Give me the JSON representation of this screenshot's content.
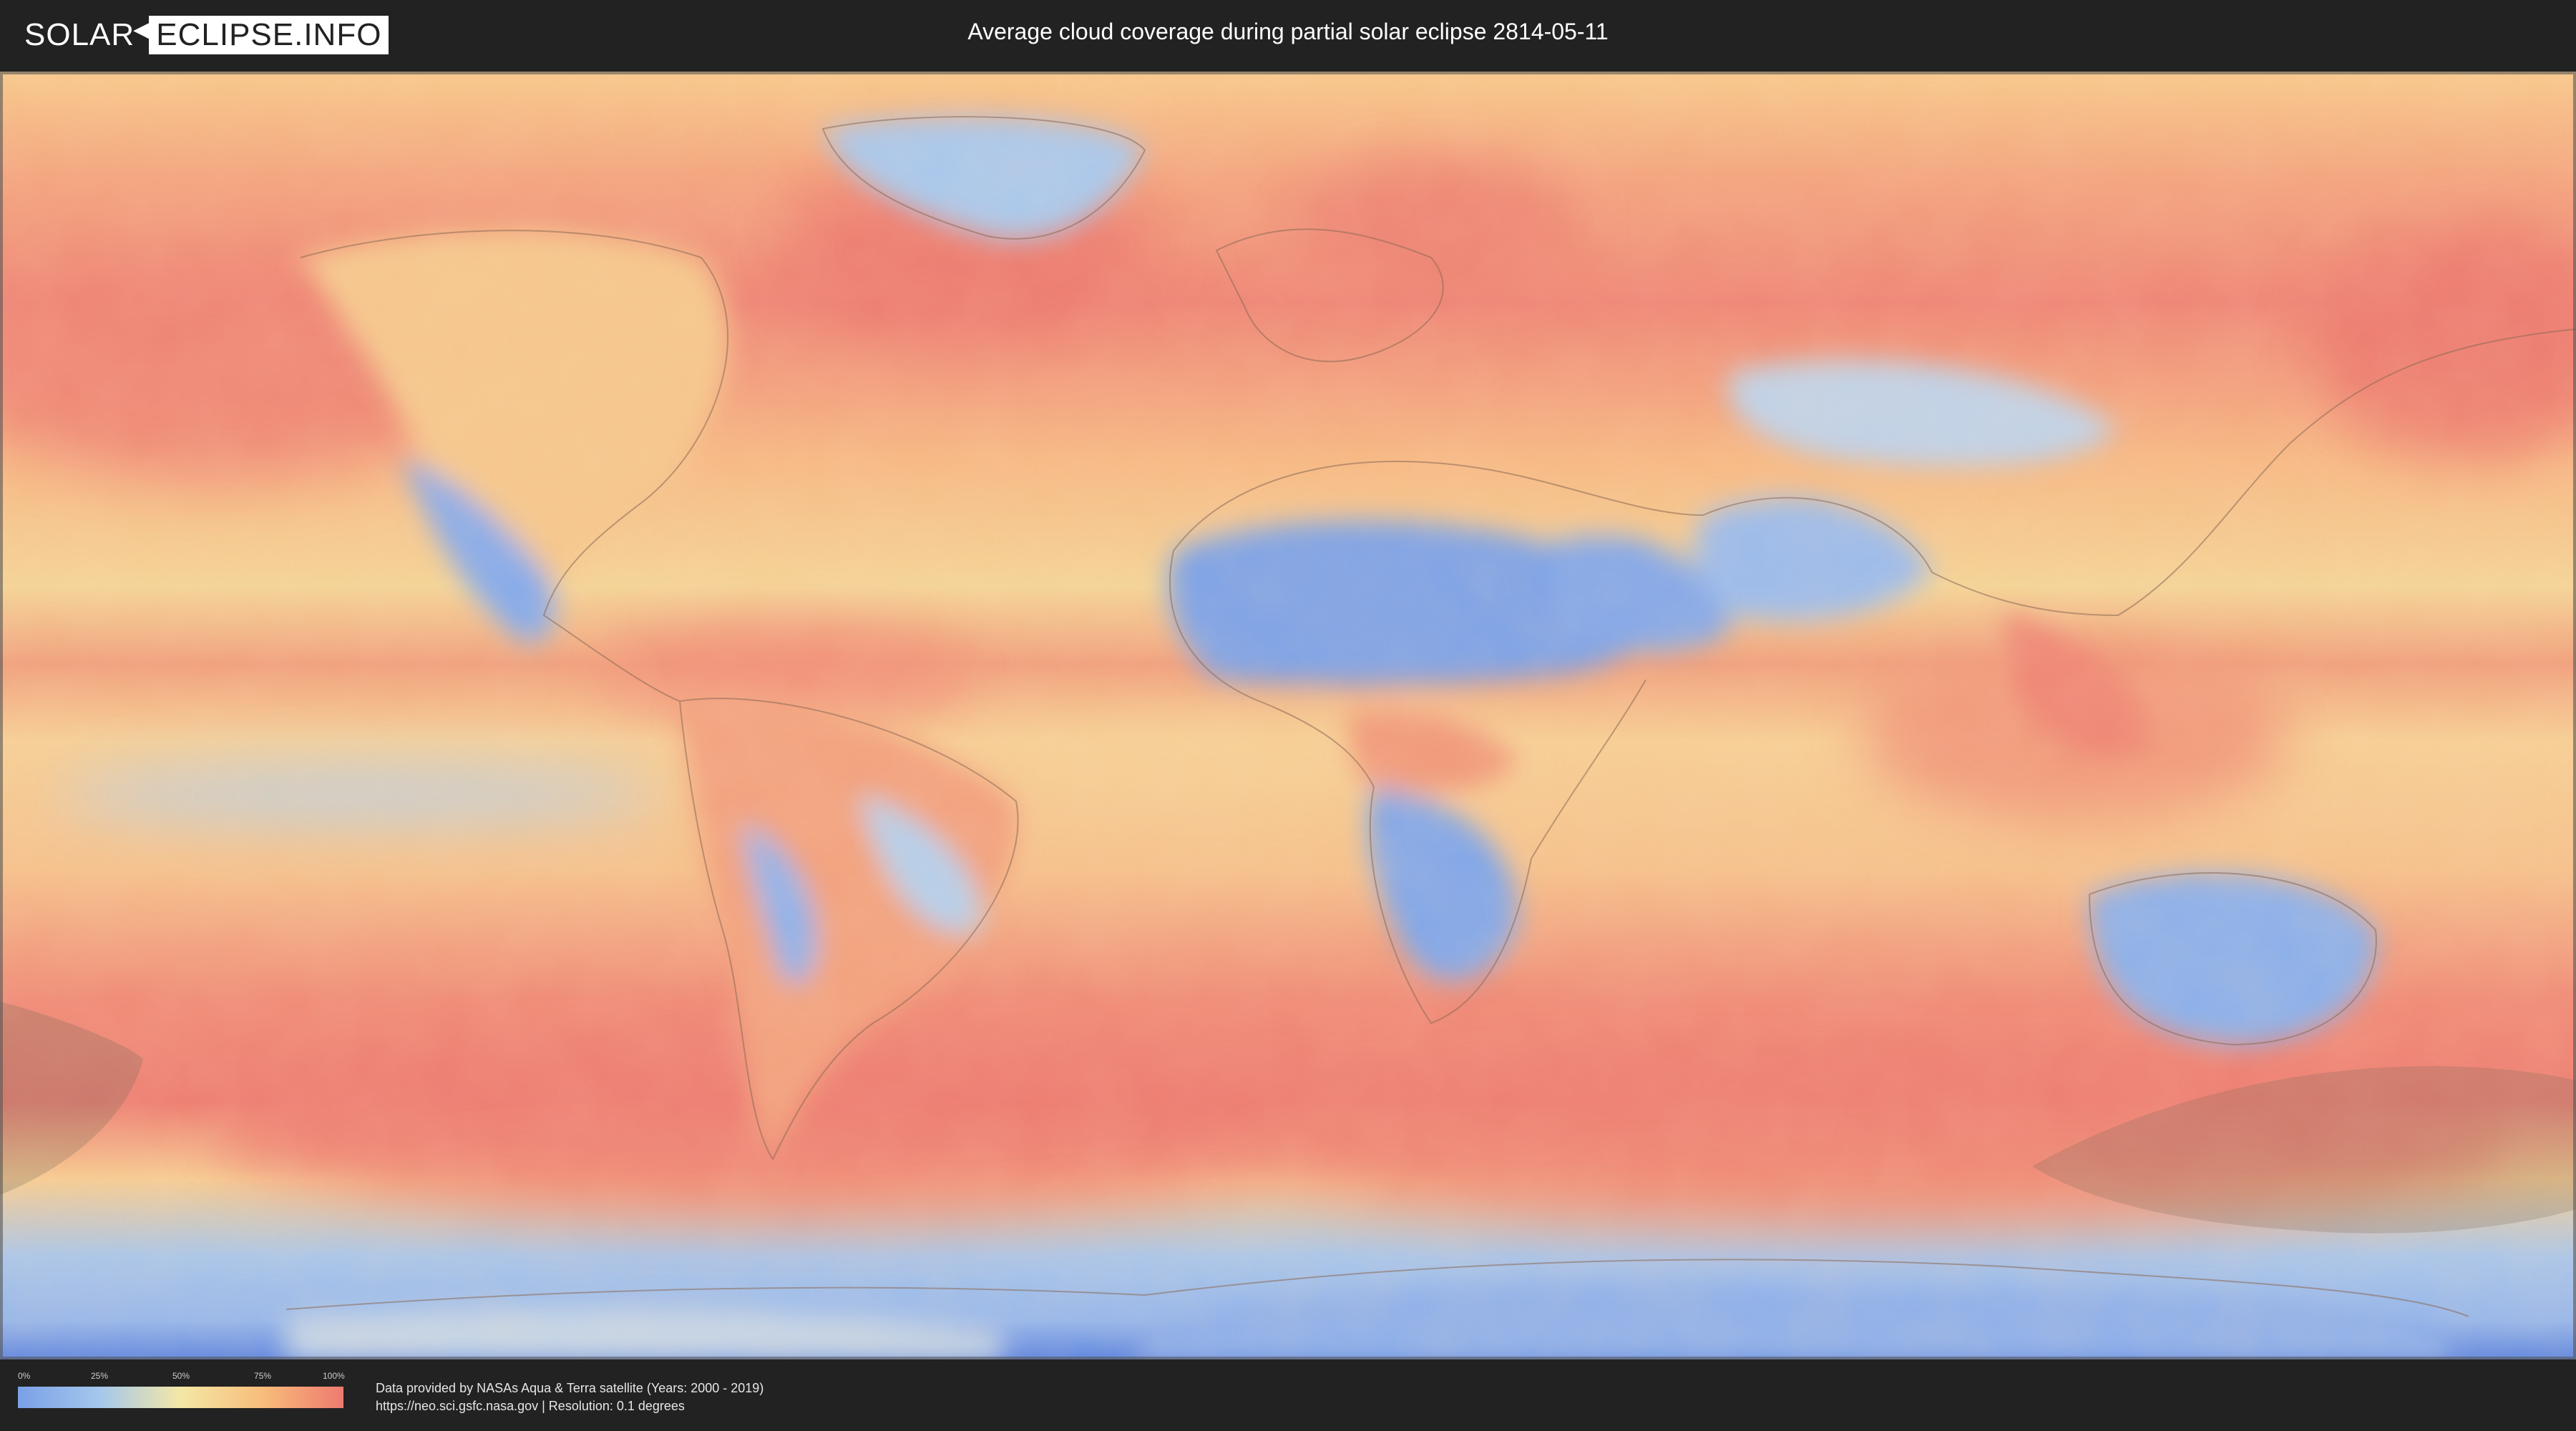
{
  "header": {
    "logo_left": "SOLAR",
    "logo_right": "ECLIPSE.INFO",
    "title": "Average cloud coverage during partial solar eclipse 2814-05-11"
  },
  "map": {
    "subject": "world cloud coverage",
    "shaded_eclipse_regions": 2,
    "colors": {
      "low": "#7aa0e6",
      "mid_low": "#a4c7ec",
      "mid": "#f4e7a6",
      "mid_high": "#f7bd7b",
      "high": "#ef7a6f",
      "ocean_band": "#f08f78",
      "eclipse_shade": "#7a6a5a"
    }
  },
  "legend": {
    "ticks": [
      "0%",
      "25%",
      "50%",
      "75%",
      "100%"
    ]
  },
  "credits": {
    "line1": "Data provided by NASAs Aqua & Terra satellite (Years: 2000 - 2019)",
    "line2": "https://neo.sci.gsfc.nasa.gov | Resolution: 0.1 degrees"
  }
}
